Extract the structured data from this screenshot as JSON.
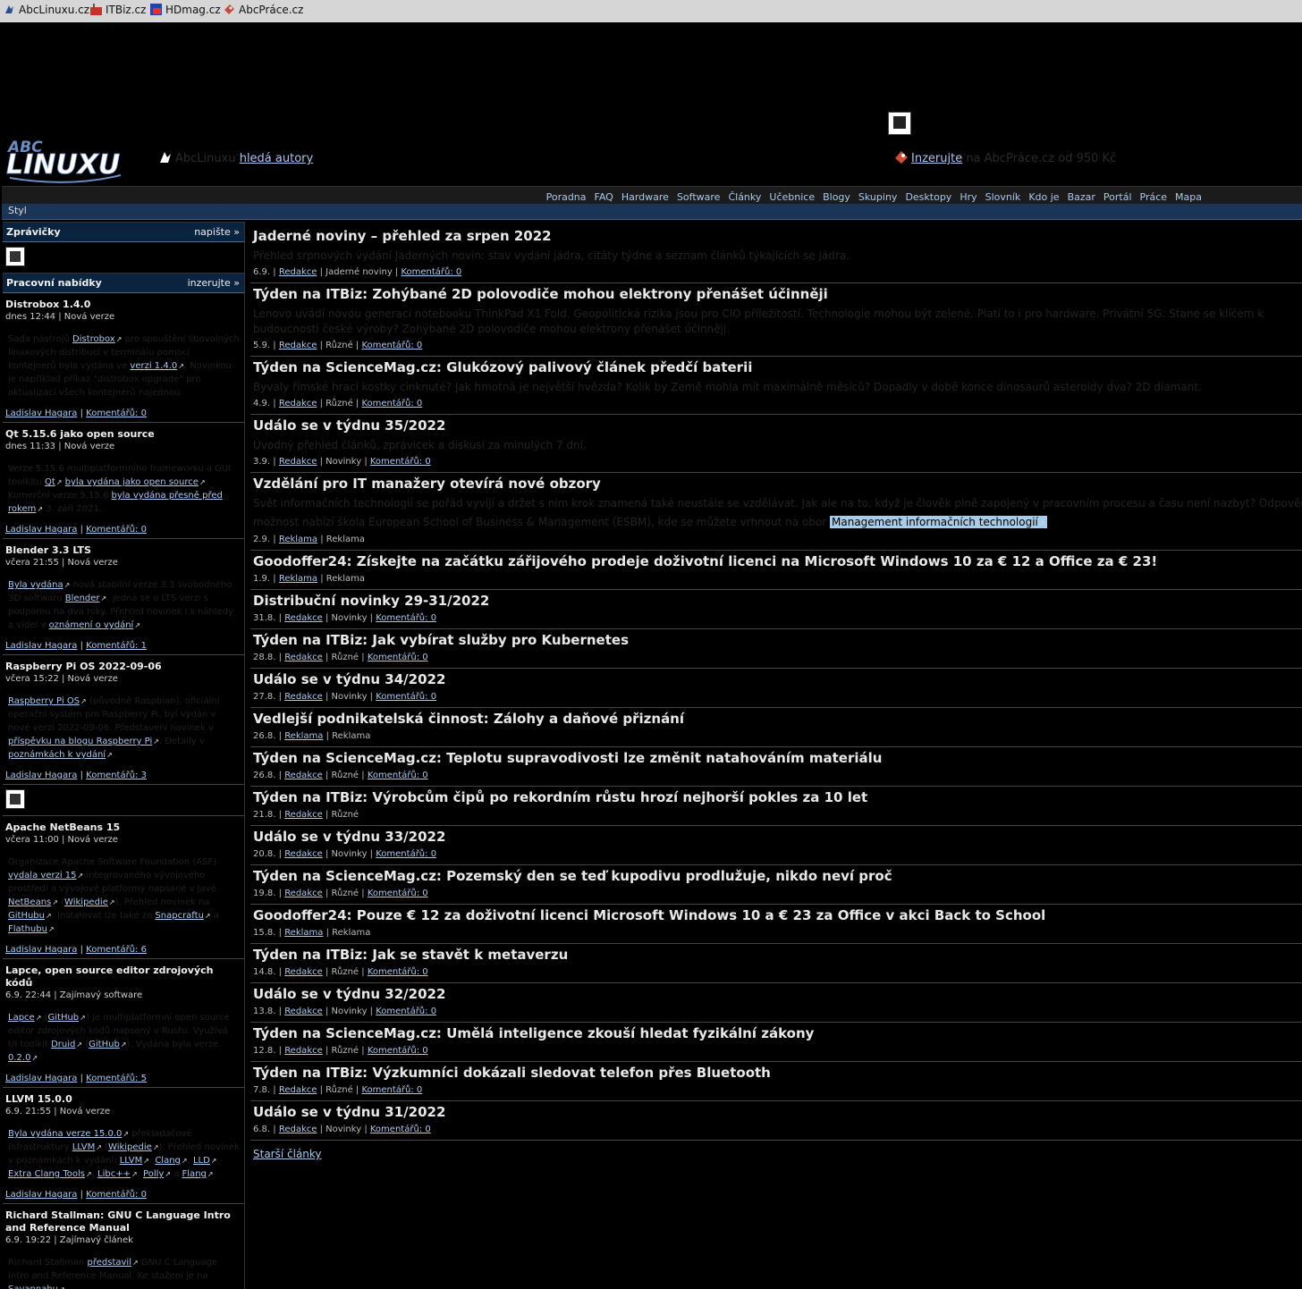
{
  "topbar": {
    "sites": [
      "AbcLinuxu.cz",
      "ITBiz.cz",
      "HDmag.cz",
      "AbcPráce.cz"
    ]
  },
  "header": {
    "logo_text_top": "ABC",
    "logo_text_bottom": "LINUXU",
    "left_promo": {
      "brand": "AbcLinuxu",
      "link": "hledá autory"
    },
    "right_promo": {
      "link": "Inzerujte",
      "text": "na AbcPráce.cz od 950 Kč"
    }
  },
  "nav": {
    "items": [
      "Poradna",
      "FAQ",
      "Hardware",
      "Software",
      "Články",
      "Učebnice",
      "Blogy",
      "Skupiny",
      "Desktopy",
      "Hry",
      "Slovník",
      "Kdo je",
      "Bazar",
      "Portál",
      "Práce",
      "Mapa"
    ],
    "style_label": "Styl"
  },
  "sidebar": {
    "close": "×",
    "news_box": {
      "title": "Zprávičky",
      "action": "napište »"
    },
    "jobs_box": {
      "title": "Pracovní nabídky",
      "action": "inzerujte »"
    },
    "news": [
      {
        "title": "Distrobox 1.4.0",
        "meta": "dnes 12:44 | Nová verze",
        "body": [
          "Sada nástrojů ",
          {
            "a": "Distrobox"
          },
          " pro spouštění libovolných linuxových distribucí v terminálu pomocí kontejnerů byla vydána ve ",
          {
            "a": "verzi 1.4.0"
          },
          ". Novinkou je například příkaz \"distrobox upgrade\" pro aktualizaci všech kontejnerů najednou."
        ],
        "author": "Ladislav Hagara",
        "comments": "Komentářů: 0"
      },
      {
        "title": "Qt 5.15.6 jako open source",
        "meta": "dnes 11:33 | Nová verze",
        "body": [
          "Verze 5.15.6 multiplatformního frameworku a GUI toolkitu ",
          {
            "a": "Qt"
          },
          " ",
          {
            "a": "byla vydána jako open source"
          },
          ". Komerční verze 5.15.6 ",
          {
            "a": "byla vydána přesně před rokem"
          },
          " 3. září 2021."
        ],
        "author": "Ladislav Hagara",
        "comments": "Komentářů: 0"
      },
      {
        "title": "Blender 3.3 LTS",
        "meta": "včera 21:55 | Nová verze",
        "body": [
          {
            "a": "Byla vydána"
          },
          " nová stabilní verze 3.3 svobodného 3D softwaru ",
          {
            "a": "Blender"
          },
          ". Jedná se o LTS verzi s podporou na dva roky. Přehled novinek i s náhledy a videi v ",
          {
            "a": "oznámení o vydání"
          },
          "."
        ],
        "author": "Ladislav Hagara",
        "comments": "Komentářů: 1"
      },
      {
        "title": "Raspberry Pi OS 2022-09-06",
        "meta": "včera 15:22 | Nová verze",
        "body": [
          {
            "a": "Raspberry Pi OS"
          },
          " (původně Raspbian), oficiální operační systém pro Raspberry Pi, byl vydán v nové verzi 2022-09-06. Představení novinek v ",
          {
            "a": "příspěvku na blogu Raspberry Pi"
          },
          ". Detaily v ",
          {
            "a": "poznámkách k vydání"
          },
          "."
        ],
        "author": "Ladislav Hagara",
        "comments": "Komentářů: 3",
        "ad_after": true
      },
      {
        "title": "Apache NetBeans 15",
        "meta": "včera 11:00 | Nová verze",
        "body": [
          "Organizace Apache Software Foundation (ASF) ",
          {
            "a": "vydala verzi 15"
          },
          " integrovaného vývojového prostředí a vývojové platformy napsané v Javě ",
          {
            "a": "NetBeans"
          },
          " (",
          {
            "a": "Wikipedie"
          },
          "). Přehled novinek na ",
          {
            "a": "GitHubu"
          },
          ". Instalovat lze také ze ",
          {
            "a": "Snapcraftu"
          },
          " a ",
          {
            "a": "Flathubu"
          },
          "."
        ],
        "author": "Ladislav Hagara",
        "comments": "Komentářů: 6"
      },
      {
        "title": "Lapce, open source editor zdrojových kódů",
        "meta": "6.9. 22:44 | Zajímavý software",
        "body": [
          {
            "a": "Lapce"
          },
          " (",
          {
            "a": "GitHub"
          },
          ") je multiplatformní open source editor zdrojových kódů napsaný v Rustu. Využívá UI toolkit ",
          {
            "a": "Druid"
          },
          " (",
          {
            "a": "GitHub"
          },
          "). Vydána byla verze ",
          {
            "a": "0.2.0"
          },
          "."
        ],
        "author": "Ladislav Hagara",
        "comments": "Komentářů: 5"
      },
      {
        "title": "LLVM 15.0.0",
        "meta": "6.9. 21:55 | Nová verze",
        "body": [
          {
            "a": "Byla vydána verze 15.0.0"
          },
          " překladačové infrastruktury ",
          {
            "a": "LLVM"
          },
          " (",
          {
            "a": "Wikipedie"
          },
          "). Přehled novinek v poznámkách k vydání: ",
          {
            "a": "LLVM"
          },
          ", ",
          {
            "a": "Clang"
          },
          ", ",
          {
            "a": "LLD"
          },
          ", ",
          {
            "a": "Extra Clang Tools"
          },
          ", ",
          {
            "a": "Libc++"
          },
          ", ",
          {
            "a": "Polly"
          },
          " a ",
          {
            "a": "Flang"
          },
          "."
        ],
        "author": "Ladislav Hagara",
        "comments": "Komentářů: 0"
      },
      {
        "title": "Richard Stallman: GNU C Language Intro and Reference Manual",
        "meta": "6.9. 19:22 | Zajímavý článek",
        "body": [
          "Richard Stallman ",
          {
            "a": "představil"
          },
          " GNU C Language Intro and Reference Manual. Ke stažení je na ",
          {
            "a": "Savannahu"
          },
          "."
        ],
        "author": "",
        "comments": ""
      }
    ]
  },
  "articles": [
    {
      "title": "Jaderné noviny – přehled za srpen 2022",
      "perex": "Přehled srpnových vydání Jaderných novin: stav vydání jádra, citáty týdne a seznam článků týkajících se jádra.",
      "date": "6.9.",
      "author": "Redakce",
      "section": "Jaderné noviny",
      "comments": "Komentářů: 0"
    },
    {
      "title": "Týden na ITBiz: Zohýbané 2D polovodiče mohou elektrony přenášet účinněji",
      "perex": "Lenovo uvádí novou generaci notebooku ThinkPad X1 Fold. Geopolitická rizika jsou pro CIO příležitostí. Technologie mohou být zelené. Platí to i pro hardware. Privátní 5G: Stane se klíčem k budoucnosti české výroby? Zohýbané 2D polovodiče mohou elektrony přenášet účinněji.",
      "two": true,
      "date": "5.9.",
      "author": "Redakce",
      "section": "Různé",
      "comments": "Komentářů: 0"
    },
    {
      "title": "Týden na ScienceMag.cz: Glukózový palivový článek předčí baterii",
      "perex": "Byvaly římské hrací kostky cinknuté? Jak hmotná je největší hvězda? Kolik by Země mohla mít maximálně měsíců? Dopadly v době konce dinosaurů asteroidy dva? 2D diamant.",
      "date": "4.9.",
      "author": "Redakce",
      "section": "Různé",
      "comments": "Komentářů: 0"
    },
    {
      "title": "Událo se v týdnu 35/2022",
      "perex": "Úvodný přehled článků, zprávicek a diskusí za minulých 7 dní.",
      "date": "3.9.",
      "author": "Redakce",
      "section": "Novinky",
      "comments": "Komentářů: 0"
    },
    {
      "title": "Vzdělání pro IT manažery otevírá nové obzory",
      "perex": "Svět informačních technologií se pořád vyvíjí a držet s ním krok znamená také neustále se vzdělávat. Jak ale na to, když je člověk plně zapojený v pracovním procesu a času není nazbyt? Odpovědí může být",
      "perex2": "možnost nabízí škola European School of Business & Management (ESBM), kde se můžete vrhnout na obor ",
      "highlight": "Management informačních technologií",
      "date": "2.9.",
      "author": "Reklama",
      "section": "Reklama",
      "comments": ""
    },
    {
      "title": "Goodoffer24: Získejte na začátku zářijového prodeje doživotní licenci na Microsoft Windows 10 za € 12 a Office za € 23!",
      "date": "1.9.",
      "author": "Reklama",
      "section": "Reklama",
      "comments": ""
    },
    {
      "title": "Distribuční novinky 29-31/2022",
      "date": "31.8.",
      "author": "Redakce",
      "section": "Novinky",
      "comments": "Komentářů: 0"
    },
    {
      "title": "Týden na ITBiz: Jak vybírat služby pro Kubernetes",
      "date": "28.8.",
      "author": "Redakce",
      "section": "Různé",
      "comments": "Komentářů: 0"
    },
    {
      "title": "Událo se v týdnu 34/2022",
      "date": "27.8.",
      "author": "Redakce",
      "section": "Novinky",
      "comments": "Komentářů: 0"
    },
    {
      "title": "Vedlejší podnikatelská činnost: Zálohy a daňové přiznání",
      "date": "26.8.",
      "author": "Reklama",
      "section": "Reklama",
      "comments": ""
    },
    {
      "title": "Týden na ScienceMag.cz: Teplotu supravodivosti lze změnit natahováním materiálu",
      "date": "26.8.",
      "author": "Redakce",
      "section": "Různé",
      "comments": "Komentářů: 0"
    },
    {
      "title": "Týden na ITBiz: Výrobcům čipů po rekordním růstu hrozí nejhorší pokles za 10 let",
      "date": "21.8.",
      "author": "Redakce",
      "section": "Různé",
      "comments": ""
    },
    {
      "title": "Událo se v týdnu 33/2022",
      "date": "20.8.",
      "author": "Redakce",
      "section": "Novinky",
      "comments": "Komentářů: 0"
    },
    {
      "title": "Týden na ScienceMag.cz: Pozemský den se teď kupodivu prodlužuje, nikdo neví proč",
      "date": "19.8.",
      "author": "Redakce",
      "section": "Různé",
      "comments": "Komentářů: 0"
    },
    {
      "title": "Goodoffer24: Pouze € 12 za doživotní licenci Microsoft Windows 10 a € 23 za Office v akci Back to School",
      "date": "15.8.",
      "author": "Reklama",
      "section": "Reklama",
      "comments": ""
    },
    {
      "title": "Týden na ITBiz: Jak se stavět k metaverzu",
      "date": "14.8.",
      "author": "Redakce",
      "section": "Různé",
      "comments": "Komentářů: 0"
    },
    {
      "title": "Událo se v týdnu 32/2022",
      "date": "13.8.",
      "author": "Redakce",
      "section": "Novinky",
      "comments": "Komentářů: 0"
    },
    {
      "title": "Týden na ScienceMag.cz: Umělá inteligence zkouší hledat fyzikální zákony",
      "date": "12.8.",
      "author": "Redakce",
      "section": "Různé",
      "comments": "Komentářů: 0"
    },
    {
      "title": "Týden na ITBiz: Výzkumníci dokázali sledovat telefon přes Bluetooth",
      "date": "7.8.",
      "author": "Redakce",
      "section": "Různé",
      "comments": "Komentářů: 0"
    },
    {
      "title": "Událo se v týdnu 31/2022",
      "date": "6.8.",
      "author": "Redakce",
      "section": "Novinky",
      "comments": "Komentářů: 0"
    }
  ],
  "older_link": "Starší články",
  "colors": {
    "background": "#000000",
    "link": "#a8c8ee",
    "nav_blue": "#1a3555",
    "box_head": "#0a2440",
    "highlight": "#a9cde8"
  }
}
